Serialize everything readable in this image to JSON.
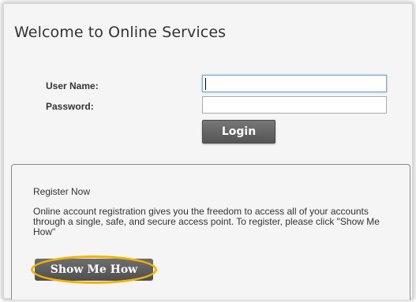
{
  "page": {
    "title": "Welcome to Online Services"
  },
  "login": {
    "username_label": "User Name:",
    "password_label": "Password:",
    "username_value": "",
    "password_value": "",
    "login_label": "Login"
  },
  "register": {
    "title": "Register Now",
    "description": "Online account registration gives you the freedom to access all of your accounts through a single, safe, and secure access point. To register, please click \"Show Me How\"",
    "button_label": "Show Me How"
  },
  "colors": {
    "highlight": "#f2b200",
    "button": "#5e5e5e"
  }
}
